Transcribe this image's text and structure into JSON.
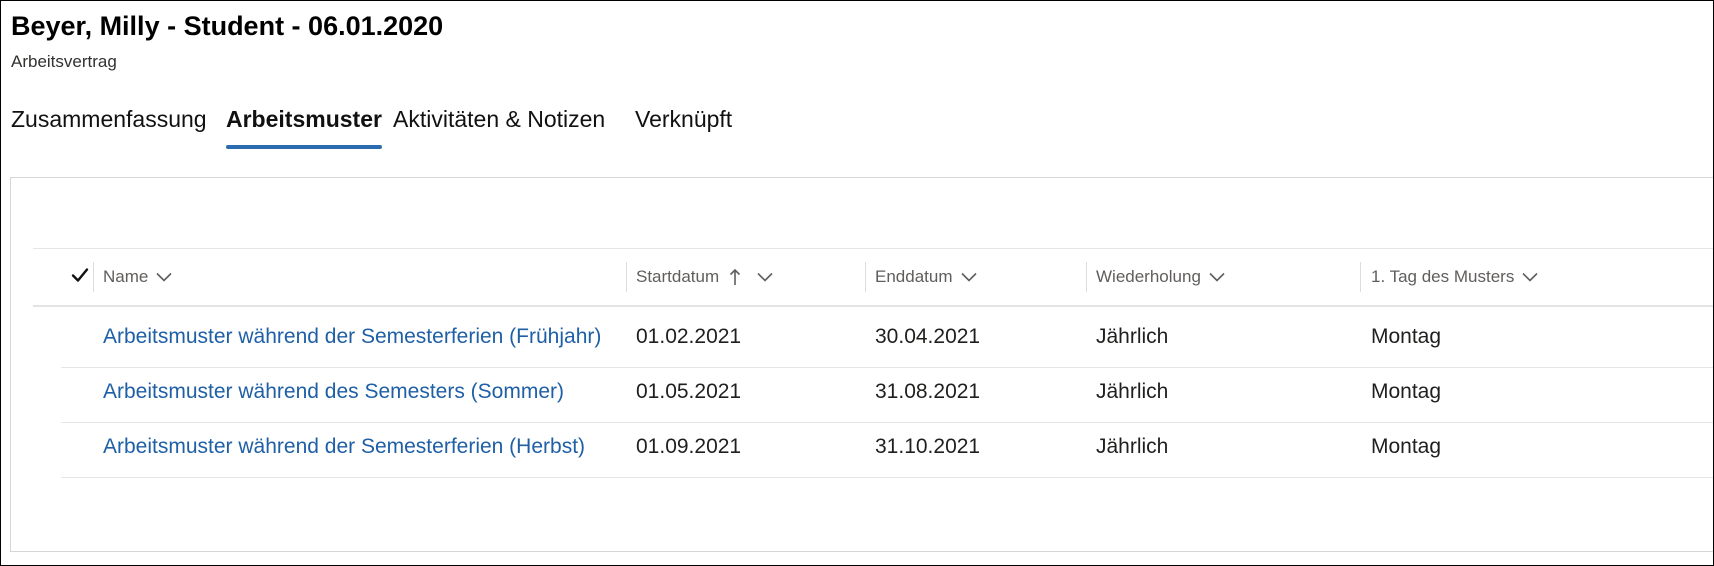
{
  "record": {
    "title": "Beyer, Milly - Student - 06.01.2020",
    "entity": "Arbeitsvertrag"
  },
  "tabs": [
    {
      "label": "Zusammenfassung",
      "active": false
    },
    {
      "label": "Arbeitsmuster",
      "active": true
    },
    {
      "label": "Aktivitäten & Notizen",
      "active": false
    },
    {
      "label": "Verknüpft",
      "active": false
    }
  ],
  "grid": {
    "columns": [
      {
        "label": "Name",
        "sort": "none",
        "menu_icon": "chevron-down-icon"
      },
      {
        "label": "Startdatum",
        "sort": "ascending",
        "sort_icon": "arrow-up-icon",
        "menu_icon": "chevron-down-icon"
      },
      {
        "label": "Enddatum",
        "sort": "none",
        "menu_icon": "chevron-down-icon"
      },
      {
        "label": "Wiederholung",
        "sort": "none",
        "menu_icon": "chevron-down-icon"
      },
      {
        "label": "1. Tag des Musters",
        "sort": "none",
        "menu_icon": "chevron-down-icon"
      }
    ],
    "rows": [
      {
        "name": "Arbeitsmuster während der Semesterferien (Frühjahr)",
        "start": "01.02.2021",
        "end": "30.04.2021",
        "recurrence": "Jährlich",
        "first_day": "Montag"
      },
      {
        "name": "Arbeitsmuster während des Semesters (Sommer)",
        "start": "01.05.2021",
        "end": "31.08.2021",
        "recurrence": "Jährlich",
        "first_day": "Montag"
      },
      {
        "name": "Arbeitsmuster während der Semesterferien (Herbst)",
        "start": "01.09.2021",
        "end": "31.10.2021",
        "recurrence": "Jährlich",
        "first_day": "Montag"
      }
    ]
  },
  "colors": {
    "link": "#1f5fa6",
    "tab_underline": "#2b6cb0",
    "header_text": "#605e5c"
  }
}
